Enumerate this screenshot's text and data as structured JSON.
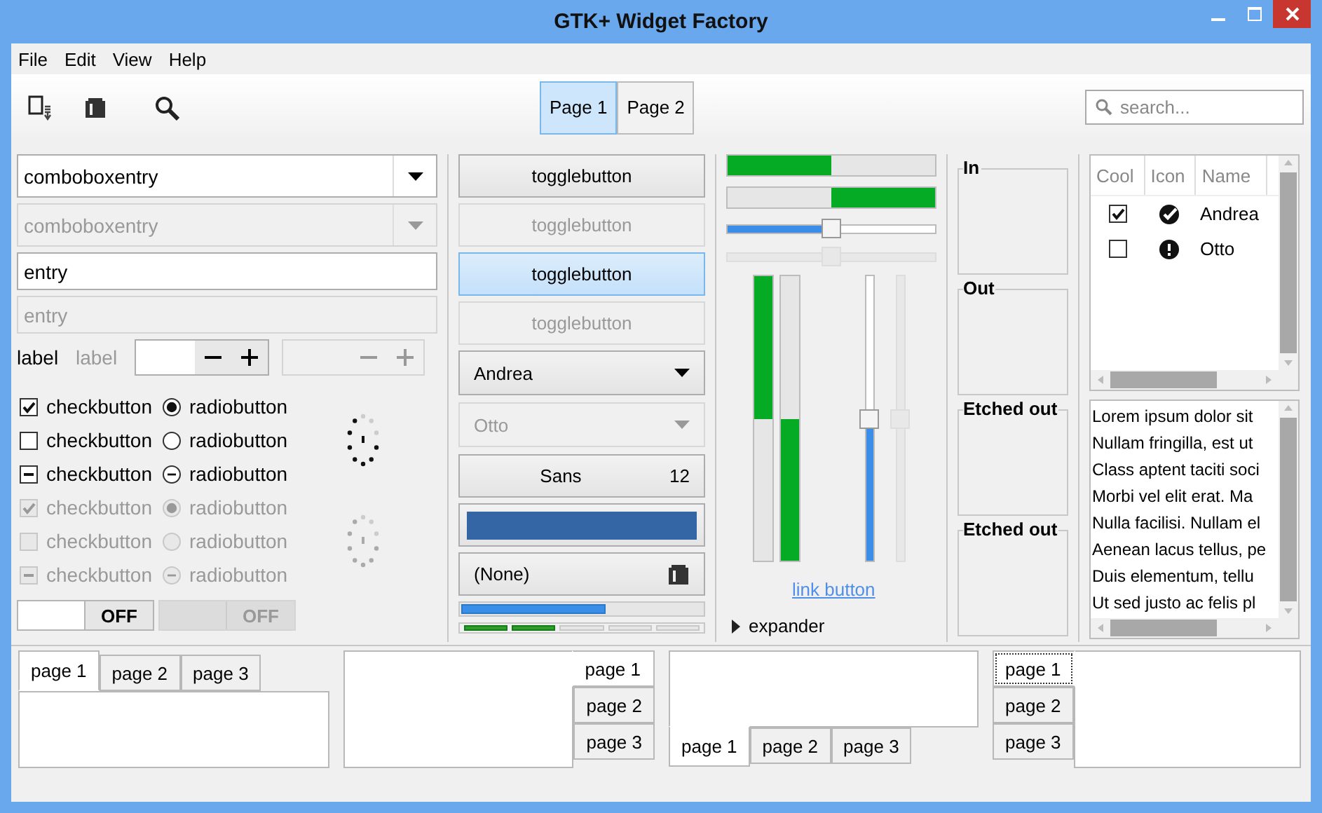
{
  "window": {
    "title": "GTK+ Widget Factory"
  },
  "menu": [
    "File",
    "Edit",
    "View",
    "Help"
  ],
  "toolbar_tabs": [
    {
      "label": "Page 1",
      "selected": true
    },
    {
      "label": "Page 2",
      "selected": false
    }
  ],
  "search": {
    "placeholder": "search..."
  },
  "combo_entries": [
    {
      "value": "comboboxentry",
      "disabled": false
    },
    {
      "value": "comboboxentry",
      "disabled": true
    }
  ],
  "entries": [
    {
      "value": "entry",
      "disabled": false
    },
    {
      "value": "entry",
      "disabled": true
    }
  ],
  "labels": [
    {
      "text": "label",
      "disabled": false
    },
    {
      "text": "label",
      "disabled": true
    }
  ],
  "spinbuttons": [
    {
      "disabled": false
    },
    {
      "disabled": true
    }
  ],
  "checkbuttons": [
    {
      "label": "checkbutton",
      "checked": true,
      "inconsistent": false,
      "disabled": false
    },
    {
      "label": "checkbutton",
      "checked": false,
      "inconsistent": false,
      "disabled": false
    },
    {
      "label": "checkbutton",
      "checked": false,
      "inconsistent": true,
      "disabled": false
    },
    {
      "label": "checkbutton",
      "checked": true,
      "inconsistent": false,
      "disabled": true
    },
    {
      "label": "checkbutton",
      "checked": false,
      "inconsistent": false,
      "disabled": true
    },
    {
      "label": "checkbutton",
      "checked": false,
      "inconsistent": true,
      "disabled": true
    }
  ],
  "radiobuttons": [
    {
      "label": "radiobutton",
      "selected": true,
      "inconsistent": false,
      "disabled": false
    },
    {
      "label": "radiobutton",
      "selected": false,
      "inconsistent": false,
      "disabled": false
    },
    {
      "label": "radiobutton",
      "selected": false,
      "inconsistent": true,
      "disabled": false
    },
    {
      "label": "radiobutton",
      "selected": true,
      "inconsistent": false,
      "disabled": true
    },
    {
      "label": "radiobutton",
      "selected": false,
      "inconsistent": false,
      "disabled": true
    },
    {
      "label": "radiobutton",
      "selected": false,
      "inconsistent": true,
      "disabled": true
    }
  ],
  "spinners": [
    {
      "disabled": false
    },
    {
      "disabled": true
    }
  ],
  "switches": [
    {
      "label": "OFF",
      "on": false,
      "disabled": false
    },
    {
      "label": "OFF",
      "on": false,
      "disabled": true
    }
  ],
  "togglebuttons": [
    {
      "label": "togglebutton",
      "active": false,
      "disabled": false
    },
    {
      "label": "togglebutton",
      "active": false,
      "disabled": true
    },
    {
      "label": "togglebutton",
      "active": true,
      "disabled": false
    },
    {
      "label": "togglebutton",
      "active": true,
      "disabled": true
    }
  ],
  "combos": [
    {
      "value": "Andrea",
      "disabled": false
    },
    {
      "value": "Otto",
      "disabled": true
    }
  ],
  "font_button": {
    "family": "Sans",
    "size": "12"
  },
  "color_button": {
    "color": "#3465a4"
  },
  "file_button": {
    "label": "(None)"
  },
  "progress_bar": {
    "level": 0.6
  },
  "level_bar": {
    "level": 0.4
  },
  "h_progress": [
    {
      "level": 0.5,
      "inverted": false
    },
    {
      "level": 0.5,
      "inverted": true
    }
  ],
  "h_scales": [
    {
      "level": 0.5,
      "disabled": false
    },
    {
      "level": 0.5,
      "disabled": true
    }
  ],
  "v_progress": [
    {
      "level": 0.5,
      "inverted": false
    },
    {
      "level": 0.5,
      "inverted": true
    }
  ],
  "v_scales": [
    {
      "level": 0.5,
      "disabled": false
    },
    {
      "level": 0.5,
      "disabled": true
    }
  ],
  "link_button": {
    "label": "link button"
  },
  "expander": {
    "label": "expander",
    "expanded": false
  },
  "frames": [
    {
      "label": "In"
    },
    {
      "label": "Out"
    },
    {
      "label": "Etched out"
    },
    {
      "label": "Etched out"
    }
  ],
  "tree": {
    "columns": [
      "Cool",
      "Icon",
      "Name"
    ],
    "rows": [
      {
        "cool": true,
        "kind": "done",
        "name": "Andrea"
      },
      {
        "cool": false,
        "kind": "alert",
        "name": "Otto"
      }
    ]
  },
  "text_view": {
    "lines": [
      "Lorem ipsum dolor sit",
      "Nullam fringilla, est ut",
      "Class aptent taciti soci",
      "Morbi vel elit erat. Ma",
      "Nulla facilisi. Nullam el",
      "Aenean lacus tellus, pe",
      "Duis elementum, tellu",
      "Ut sed justo ac felis pl"
    ]
  },
  "notebooks": [
    {
      "kind": "top",
      "tabs": [
        {
          "label": "page 1",
          "selected": true
        },
        {
          "label": "page 2",
          "selected": false
        },
        {
          "label": "page 3",
          "selected": false
        }
      ]
    },
    {
      "kind": "right",
      "tabs": [
        {
          "label": "page 1",
          "selected": true
        },
        {
          "label": "page 2",
          "selected": false
        },
        {
          "label": "page 3",
          "selected": false
        }
      ]
    },
    {
      "kind": "bottom",
      "tabs": [
        {
          "label": "page 1",
          "selected": true
        },
        {
          "label": "page 2",
          "selected": false
        },
        {
          "label": "page 3",
          "selected": false
        }
      ]
    },
    {
      "kind": "left",
      "tabs": [
        {
          "label": "page 1",
          "selected": true
        },
        {
          "label": "page 2",
          "selected": false
        },
        {
          "label": "page 3",
          "selected": false
        }
      ]
    }
  ]
}
